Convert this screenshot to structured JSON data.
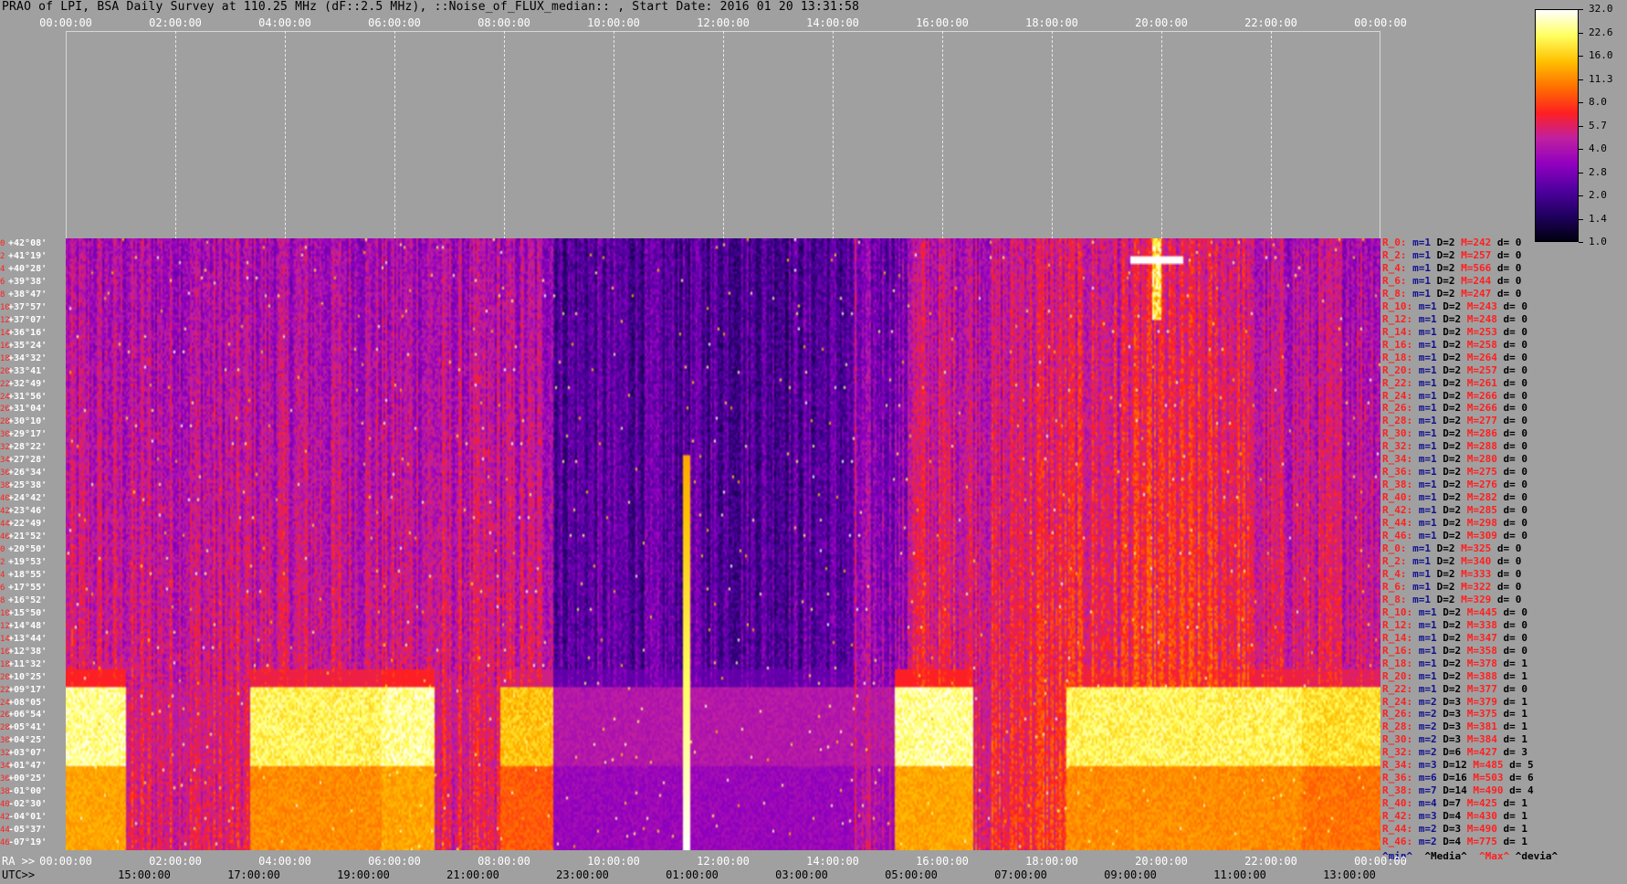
{
  "title": "PRAO of LPI, BSA Daily Survey at 110.25 MHz (dF::2.5 MHz), ::Noise_of_FLUX_median:: , Start Date: 2016 01 20 13:31:58",
  "chart_data": {
    "type": "heatmap",
    "title": "PRAO of LPI, BSA Daily Survey at 110.25 MHz (dF::2.5 MHz), ::Noise_of_FLUX_median:: , Start Date: 2016 01 20 13:31:58",
    "top_axis_ticks": [
      "00:00:00",
      "02:00:00",
      "04:00:00",
      "06:00:00",
      "08:00:00",
      "10:00:00",
      "12:00:00",
      "14:00:00",
      "16:00:00",
      "18:00:00",
      "20:00:00",
      "22:00:00",
      "00:00:00"
    ],
    "ra_axis_label": "RA >>",
    "ra_axis_ticks": [
      "00:00:00",
      "02:00:00",
      "04:00:00",
      "06:00:00",
      "08:00:00",
      "10:00:00",
      "12:00:00",
      "14:00:00",
      "16:00:00",
      "18:00:00",
      "20:00:00",
      "22:00:00",
      "00:00:00"
    ],
    "utc_axis_label": "UTC>>",
    "utc_axis_ticks": [
      "15:00:00",
      "17:00:00",
      "19:00:00",
      "21:00:00",
      "23:00:00",
      "01:00:00",
      "03:00:00",
      "05:00:00",
      "07:00:00",
      "09:00:00",
      "11:00:00",
      "13:00:00"
    ],
    "declinations": [
      "+42°08'",
      "+41°19'",
      "+40°28'",
      "+39°38'",
      "+38°47'",
      "+37°57'",
      "+37°07'",
      "+36°16'",
      "+35°24'",
      "+34°32'",
      "+33°41'",
      "+32°49'",
      "+31°56'",
      "+31°04'",
      "+30°10'",
      "+29°17'",
      "+28°22'",
      "+27°28'",
      "+26°34'",
      "+25°38'",
      "+24°42'",
      "+23°46'",
      "+22°49'",
      "+21°52'",
      "+20°50'",
      "+19°53'",
      "+18°55'",
      "+17°55'",
      "+16°52'",
      "+15°50'",
      "+14°48'",
      "+13°44'",
      "+12°38'",
      "+11°32'",
      "+10°25'",
      "+09°17'",
      "+08°05'",
      "+06°54'",
      "+05°41'",
      "+04°25'",
      "+03°07'",
      "+01°47'",
      "+00°25'",
      "-01°00'",
      "-02°30'",
      "-04°01'",
      "-05°37'",
      "-07°19'"
    ],
    "row_indices": [
      "0",
      "2",
      "4",
      "6",
      "8",
      "10",
      "12",
      "14",
      "16",
      "18",
      "20",
      "22",
      "24",
      "26",
      "28",
      "30",
      "32",
      "34",
      "36",
      "38",
      "40",
      "42",
      "44",
      "46",
      "0",
      "2",
      "4",
      "6",
      "8",
      "10",
      "12",
      "14",
      "16",
      "18",
      "20",
      "22",
      "24",
      "26",
      "28",
      "30",
      "32",
      "34",
      "36",
      "38",
      "40",
      "42",
      "44",
      "46"
    ],
    "row_stats": [
      {
        "r": "R_0:",
        "m": "m=1",
        "D": "D=2",
        "M": "M=242",
        "d": "d= 0"
      },
      {
        "r": "R_2:",
        "m": "m=1",
        "D": "D=2",
        "M": "M=257",
        "d": "d= 0"
      },
      {
        "r": "R_4:",
        "m": "m=1",
        "D": "D=2",
        "M": "M=566",
        "d": "d= 0"
      },
      {
        "r": "R_6:",
        "m": "m=1",
        "D": "D=2",
        "M": "M=244",
        "d": "d= 0"
      },
      {
        "r": "R_8:",
        "m": "m=1",
        "D": "D=2",
        "M": "M=247",
        "d": "d= 0"
      },
      {
        "r": "R_10:",
        "m": "m=1",
        "D": "D=2",
        "M": "M=243",
        "d": "d= 0"
      },
      {
        "r": "R_12:",
        "m": "m=1",
        "D": "D=2",
        "M": "M=248",
        "d": "d= 0"
      },
      {
        "r": "R_14:",
        "m": "m=1",
        "D": "D=2",
        "M": "M=253",
        "d": "d= 0"
      },
      {
        "r": "R_16:",
        "m": "m=1",
        "D": "D=2",
        "M": "M=258",
        "d": "d= 0"
      },
      {
        "r": "R_18:",
        "m": "m=1",
        "D": "D=2",
        "M": "M=264",
        "d": "d= 0"
      },
      {
        "r": "R_20:",
        "m": "m=1",
        "D": "D=2",
        "M": "M=257",
        "d": "d= 0"
      },
      {
        "r": "R_22:",
        "m": "m=1",
        "D": "D=2",
        "M": "M=261",
        "d": "d= 0"
      },
      {
        "r": "R_24:",
        "m": "m=1",
        "D": "D=2",
        "M": "M=266",
        "d": "d= 0"
      },
      {
        "r": "R_26:",
        "m": "m=1",
        "D": "D=2",
        "M": "M=266",
        "d": "d= 0"
      },
      {
        "r": "R_28:",
        "m": "m=1",
        "D": "D=2",
        "M": "M=277",
        "d": "d= 0"
      },
      {
        "r": "R_30:",
        "m": "m=1",
        "D": "D=2",
        "M": "M=286",
        "d": "d= 0"
      },
      {
        "r": "R_32:",
        "m": "m=1",
        "D": "D=2",
        "M": "M=288",
        "d": "d= 0"
      },
      {
        "r": "R_34:",
        "m": "m=1",
        "D": "D=2",
        "M": "M=280",
        "d": "d= 0"
      },
      {
        "r": "R_36:",
        "m": "m=1",
        "D": "D=2",
        "M": "M=275",
        "d": "d= 0"
      },
      {
        "r": "R_38:",
        "m": "m=1",
        "D": "D=2",
        "M": "M=276",
        "d": "d= 0"
      },
      {
        "r": "R_40:",
        "m": "m=1",
        "D": "D=2",
        "M": "M=282",
        "d": "d= 0"
      },
      {
        "r": "R_42:",
        "m": "m=1",
        "D": "D=2",
        "M": "M=285",
        "d": "d= 0"
      },
      {
        "r": "R_44:",
        "m": "m=1",
        "D": "D=2",
        "M": "M=298",
        "d": "d= 0"
      },
      {
        "r": "R_46:",
        "m": "m=1",
        "D": "D=2",
        "M": "M=309",
        "d": "d= 0"
      },
      {
        "r": "R_0:",
        "m": "m=1",
        "D": "D=2",
        "M": "M=325",
        "d": "d= 0"
      },
      {
        "r": "R_2:",
        "m": "m=1",
        "D": "D=2",
        "M": "M=340",
        "d": "d= 0"
      },
      {
        "r": "R_4:",
        "m": "m=1",
        "D": "D=2",
        "M": "M=333",
        "d": "d= 0"
      },
      {
        "r": "R_6:",
        "m": "m=1",
        "D": "D=2",
        "M": "M=322",
        "d": "d= 0"
      },
      {
        "r": "R_8:",
        "m": "m=1",
        "D": "D=2",
        "M": "M=329",
        "d": "d= 0"
      },
      {
        "r": "R_10:",
        "m": "m=1",
        "D": "D=2",
        "M": "M=445",
        "d": "d= 0"
      },
      {
        "r": "R_12:",
        "m": "m=1",
        "D": "D=2",
        "M": "M=338",
        "d": "d= 0"
      },
      {
        "r": "R_14:",
        "m": "m=1",
        "D": "D=2",
        "M": "M=347",
        "d": "d= 0"
      },
      {
        "r": "R_16:",
        "m": "m=1",
        "D": "D=2",
        "M": "M=358",
        "d": "d= 0"
      },
      {
        "r": "R_18:",
        "m": "m=1",
        "D": "D=2",
        "M": "M=378",
        "d": "d= 1"
      },
      {
        "r": "R_20:",
        "m": "m=1",
        "D": "D=2",
        "M": "M=388",
        "d": "d= 1"
      },
      {
        "r": "R_22:",
        "m": "m=1",
        "D": "D=2",
        "M": "M=377",
        "d": "d= 0"
      },
      {
        "r": "R_24:",
        "m": "m=2",
        "D": "D=3",
        "M": "M=379",
        "d": "d= 1"
      },
      {
        "r": "R_26:",
        "m": "m=2",
        "D": "D=3",
        "M": "M=375",
        "d": "d= 1"
      },
      {
        "r": "R_28:",
        "m": "m=2",
        "D": "D=3",
        "M": "M=381",
        "d": "d= 1"
      },
      {
        "r": "R_30:",
        "m": "m=2",
        "D": "D=3",
        "M": "M=384",
        "d": "d= 1"
      },
      {
        "r": "R_32:",
        "m": "m=2",
        "D": "D=6",
        "M": "M=427",
        "d": "d= 3"
      },
      {
        "r": "R_34:",
        "m": "m=3",
        "D": "D=12",
        "M": "M=485",
        "d": "d= 5"
      },
      {
        "r": "R_36:",
        "m": "m=6",
        "D": "D=16",
        "M": "M=503",
        "d": "d= 6"
      },
      {
        "r": "R_38:",
        "m": "m=7",
        "D": "D=14",
        "M": "M=490",
        "d": "d= 4"
      },
      {
        "r": "R_40:",
        "m": "m=4",
        "D": "D=7",
        "M": "M=425",
        "d": "d= 1"
      },
      {
        "r": "R_42:",
        "m": "m=3",
        "D": "D=4",
        "M": "M=430",
        "d": "d= 1"
      },
      {
        "r": "R_44:",
        "m": "m=2",
        "D": "D=3",
        "M": "M=490",
        "d": "d= 1"
      },
      {
        "r": "R_46:",
        "m": "m=2",
        "D": "D=4",
        "M": "M=775",
        "d": "d= 1"
      }
    ],
    "stats_legend": {
      "min": "^min^",
      "median": "^Media^",
      "max": "^Max^",
      "dev": "^devia^"
    },
    "colorbar": {
      "ticks": [
        "32.0",
        "22.6",
        "16.0",
        "11.3",
        "8.0",
        "5.7",
        "4.0",
        "2.8",
        "2.0",
        "1.4",
        "1.0"
      ],
      "range": [
        1.0,
        32.0
      ],
      "scale": "log",
      "colormap": [
        "#000010",
        "#200060",
        "#5000a0",
        "#9000c0",
        "#c020a0",
        "#ff2020",
        "#ff7000",
        "#ffc000",
        "#ffff60",
        "#ffffff"
      ]
    },
    "bright_bands_utc": [
      "15:00-17:00",
      "17:00-20:30",
      "21:00-23:00",
      "05:00-13:30"
    ],
    "quiet_region_utc": "23:00-05:00"
  }
}
